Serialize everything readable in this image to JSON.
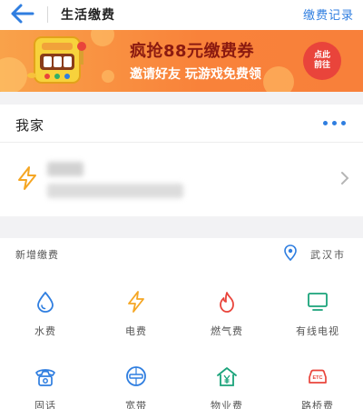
{
  "header": {
    "title": "生活缴费",
    "link": "缴费记录",
    "back_icon": "back-arrow-icon"
  },
  "banner": {
    "headline": "疯抢88元缴费券",
    "subline": "邀请好友 玩游戏免费领",
    "cta": "点此前往",
    "slides": 2,
    "active_slide": 1,
    "colors": {
      "gradient_start": "#f9a24a",
      "gradient_end": "#f8803a",
      "headline": "#8b1a10",
      "cta_bg": "#e9443b",
      "active_dot": "#2f7ee0"
    }
  },
  "home": {
    "title": "我家",
    "more_icon": "more-dots-icon",
    "account": {
      "type_icon": "electricity-icon",
      "chevron_icon": "chevron-right-icon"
    }
  },
  "new_payment": {
    "label": "新增缴费",
    "city": "武汉市",
    "location_icon": "location-pin-icon"
  },
  "categories": [
    {
      "label": "水费",
      "icon": "water-drop-icon"
    },
    {
      "label": "电费",
      "icon": "lightning-icon"
    },
    {
      "label": "燃气费",
      "icon": "flame-icon"
    },
    {
      "label": "有线电视",
      "icon": "tv-icon"
    },
    {
      "label": "固话",
      "icon": "telephone-icon"
    },
    {
      "label": "宽带",
      "icon": "broadband-icon"
    },
    {
      "label": "物业费",
      "icon": "property-house-icon"
    },
    {
      "label": "路桥费",
      "icon": "etc-car-icon"
    }
  ],
  "theme": {
    "accent": "#2f7ee0",
    "orange": "#f5a623",
    "red": "#e9443b",
    "green": "#1aa37a",
    "background_band": "#f2f2f4"
  }
}
